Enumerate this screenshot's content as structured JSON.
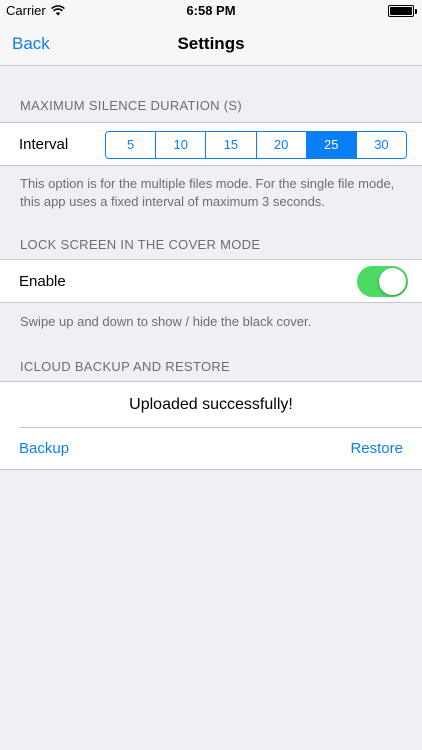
{
  "status_bar": {
    "carrier": "Carrier",
    "time": "6:58 PM"
  },
  "nav": {
    "back_label": "Back",
    "title": "Settings"
  },
  "silence": {
    "header": "MAXIMUM SILENCE DURATION (S)",
    "interval_label": "Interval",
    "options": [
      "5",
      "10",
      "15",
      "20",
      "25",
      "30"
    ],
    "selected": "25",
    "footer": "This option is for the multiple files mode. For the single file mode,  this app uses a fixed interval of maximum 3 seconds."
  },
  "lock": {
    "header": "LOCK SCREEN IN THE COVER MODE",
    "enable_label": "Enable",
    "enabled": true,
    "footer": "Swipe up and down to show / hide the black cover."
  },
  "icloud": {
    "header": "ICLOUD BACKUP AND RESTORE",
    "status": "Uploaded successfully!",
    "backup_label": "Backup",
    "restore_label": "Restore"
  },
  "colors": {
    "accent": "#0a7ff5",
    "toggle_on": "#4cd964",
    "background": "#efeff4"
  }
}
